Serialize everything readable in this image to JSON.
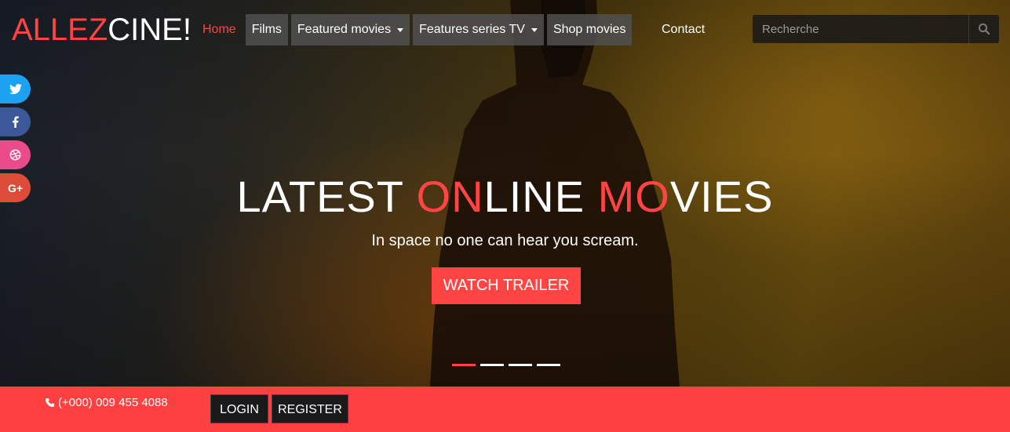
{
  "logo": {
    "part1": "ALLEZ",
    "part2": "CINE!"
  },
  "nav": {
    "items": [
      {
        "label": "Home"
      },
      {
        "label": "Films"
      },
      {
        "label": "Featured movies"
      },
      {
        "label": "Features series TV"
      },
      {
        "label": "Shop movies"
      }
    ],
    "contact": "Contact"
  },
  "search": {
    "placeholder": "Recherche"
  },
  "social": {
    "twitter": "twitter-icon",
    "facebook": "facebook-icon",
    "dribbble": "dribbble-icon",
    "google_plus": "G+"
  },
  "hero": {
    "title_parts": [
      "LATEST ",
      "ON",
      "LINE ",
      "MO",
      "VIES"
    ],
    "subtitle": "In space no one can hear you scream.",
    "button": "WATCH TRAILER",
    "slide_count": 4,
    "active_slide": 1
  },
  "footer_bar": {
    "phone": "(+000) 009 455 4088",
    "login": "LOGIN",
    "register": "REGISTER"
  },
  "colors": {
    "accent": "#ff4444",
    "bar": "#ff4040",
    "dark": "#1a1a1a"
  }
}
